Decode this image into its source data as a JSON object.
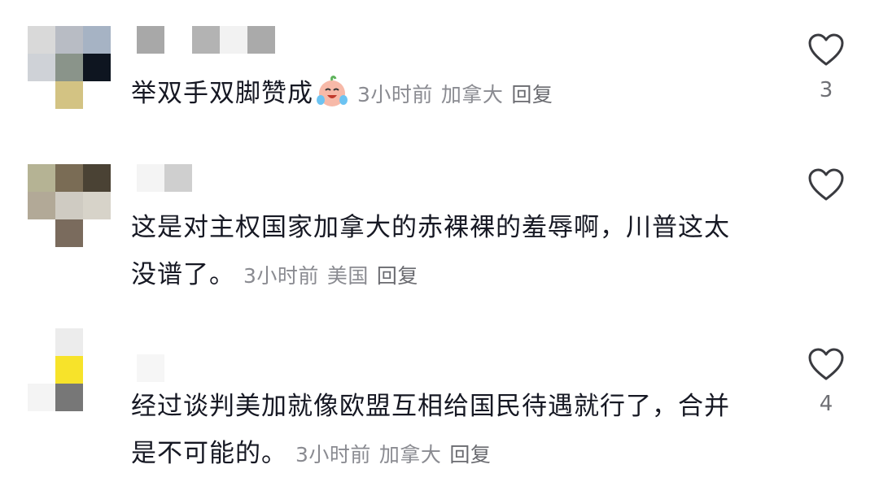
{
  "comments": [
    {
      "username": "",
      "text": "举双手双脚赞成",
      "emoji": "crying-laughing-face-emoji",
      "time": "3小时前",
      "location": "加拿大",
      "reply_label": "回复",
      "like_count": "3",
      "avatar_colors": [
        "#d9d9d9",
        "#b8bcc4",
        "#a6b3c4",
        "#cfd2d7",
        "#8a948a",
        "#0e1520",
        "#ffffff",
        "#d3c383",
        "#ffffff"
      ],
      "name_colors": [
        "#a8a8a8",
        "#b3b3b3",
        "#f2f2f2",
        "#aaaaaa"
      ]
    },
    {
      "username": "",
      "text": "这是对主权国家加拿大的赤裸裸的羞辱啊，川普这太没谱了。",
      "emoji": "",
      "time": "3小时前",
      "location": "美国",
      "reply_label": "回复",
      "like_count": "",
      "avatar_colors": [
        "#b5b394",
        "#7a6c55",
        "#4a4234",
        "#b2a997",
        "#cfcbc2",
        "#d7d3c9",
        "#ffffff",
        "#7a6b5d",
        "#ffffff"
      ],
      "name_colors": [
        "#f4f4f4",
        "#cfcfcf"
      ]
    },
    {
      "username": "",
      "text": "经过谈判美加就像欧盟互相给国民待遇就行了，合并是不可能的。",
      "emoji": "",
      "time": "3小时前",
      "location": "加拿大",
      "reply_label": "回复",
      "like_count": "4",
      "avatar_colors": [
        "#ffffff",
        "#ececec",
        "#ffffff",
        "#ffffff",
        "#f7e32a",
        "#ffffff",
        "#f4f4f4",
        "#777777",
        "#ffffff"
      ],
      "name_colors": [
        "#f6f6f6"
      ]
    }
  ]
}
